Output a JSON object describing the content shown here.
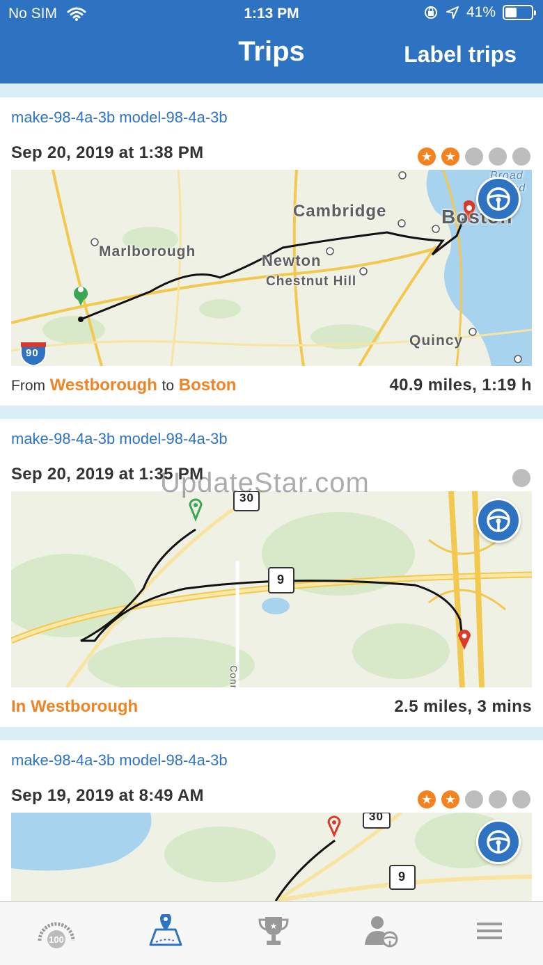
{
  "status_bar": {
    "carrier": "No SIM",
    "time": "1:13 PM",
    "battery_percent": "41%",
    "battery_level": 0.41
  },
  "header": {
    "title": "Trips",
    "action_label": "Label trips"
  },
  "trips": [
    {
      "car": "make-98-4a-3b model-98-4a-3b",
      "date": "Sep 20, 2019 at 1:38 PM",
      "rating": 2,
      "rating_max": 5,
      "from_label": "From",
      "from_place": "Westborough",
      "to_label": "to",
      "to_place": "Boston",
      "stats": "40.9 miles, 1:19 h",
      "map_labels": [
        "Cambridge",
        "Boston",
        "Marlborough",
        "Newton",
        "Chestnut Hill",
        "Quincy",
        "Broad Sound",
        "90"
      ]
    },
    {
      "car": "make-98-4a-3b model-98-4a-3b",
      "date": "Sep 20, 2019 at 1:35 PM",
      "rating": 0,
      "rating_max": 1,
      "in_label": "In Westborough",
      "stats": "2.5 miles, 3 mins",
      "map_labels": [
        "30",
        "9",
        "Conn"
      ]
    },
    {
      "car": "make-98-4a-3b model-98-4a-3b",
      "date": "Sep 19, 2019 at 8:49 AM",
      "rating": 2,
      "rating_max": 5,
      "map_labels": [
        "30",
        "9"
      ]
    }
  ],
  "watermark": "UpdateStar.com",
  "tabbar": {
    "tabs": [
      {
        "icon": "score-gauge-icon",
        "label": "100"
      },
      {
        "icon": "trips-map-icon",
        "active": true
      },
      {
        "icon": "trophy-icon"
      },
      {
        "icon": "profile-driver-icon"
      },
      {
        "icon": "menu-icon"
      }
    ]
  },
  "colors": {
    "brand_blue": "#2d73c2",
    "orange": "#ee8424",
    "route": "#111111",
    "start_pin": "#3aa552",
    "end_pin": "#d93a2b"
  }
}
